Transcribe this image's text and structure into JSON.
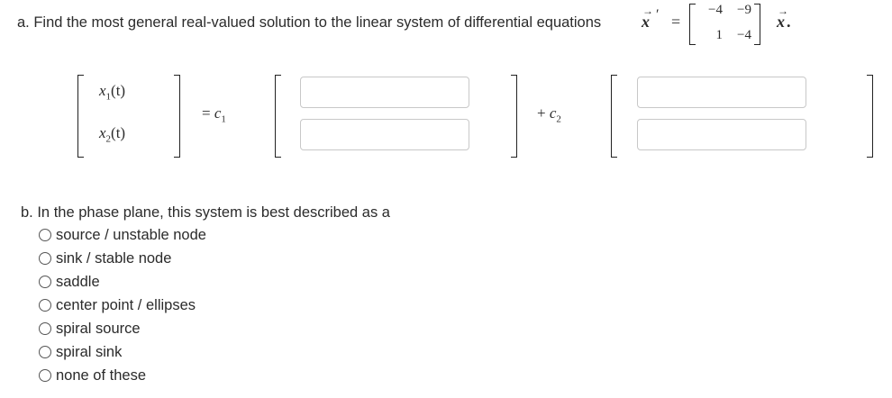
{
  "part_a": {
    "prompt": "a. Find the most general real-valued solution to the linear system of differential equations",
    "lhs_var": "x",
    "equals": "=",
    "matrix": {
      "a11": "−4",
      "a12": "−9",
      "a21": "1",
      "a22": "−4"
    },
    "rhs_var": "x",
    "period": ".",
    "x1_label": "x",
    "x1_sub": "1",
    "x1_arg": "(t)",
    "x2_label": "x",
    "x2_sub": "2",
    "x2_arg": "(t)",
    "eq_c1": "= c",
    "c1_sub": "1",
    "plus_c2": "+ c",
    "c2_sub": "2",
    "inputs": {
      "v1_top": "",
      "v1_bottom": "",
      "v2_top": "",
      "v2_bottom": ""
    }
  },
  "part_b": {
    "prompt": "b. In the phase plane, this system is best described as a",
    "options": [
      "source / unstable node",
      "sink / stable node",
      "saddle",
      "center point / ellipses",
      "spiral source",
      "spiral sink",
      "none of these"
    ]
  }
}
